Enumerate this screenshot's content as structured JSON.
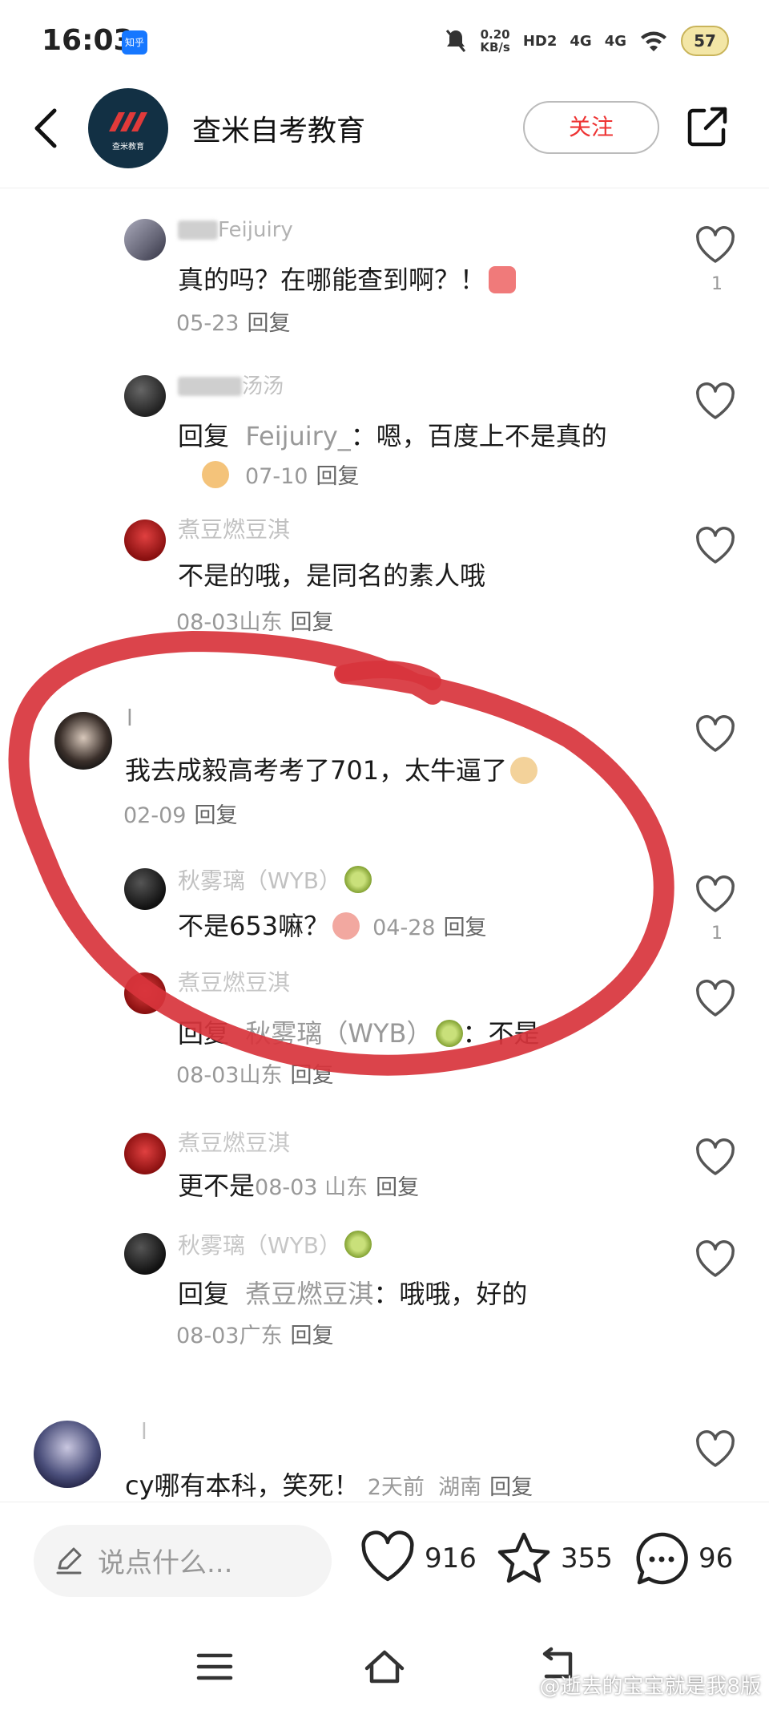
{
  "status_bar": {
    "time": "16:03",
    "app_badge": "知乎",
    "net_speed": "0.20",
    "net_unit": "KB/s",
    "hd": "HD2",
    "sig1": "4G",
    "sig2": "4G",
    "battery": "57"
  },
  "header": {
    "title": "查米自考教育",
    "logo_text": "查米教育",
    "follow_label": "关注"
  },
  "comments": [
    {
      "user": "Feijuiry",
      "text": "真的吗？在哪能查到啊？！",
      "date": "05-23",
      "reply": "回复",
      "likes": "1"
    },
    {
      "user": "汤汤",
      "reply_prefix": "回复",
      "reply_to": "Feijuiry_",
      "text": "：嗯，百度上不是真的",
      "date": "07-10",
      "reply": "回复"
    },
    {
      "user": "煮豆燃豆淇",
      "text": "不是的哦，是同名的素人哦",
      "date": "08-03",
      "loc": "山东",
      "reply": "回复"
    },
    {
      "user": "l",
      "text": "我去成毅高考考了701，太牛逼了",
      "date": "02-09",
      "reply": "回复"
    },
    {
      "user": "秋雾璃（WYB）",
      "text": "不是653嘛？",
      "date": "04-28",
      "reply": "回复",
      "likes": "1"
    },
    {
      "user": "煮豆燃豆淇",
      "reply_prefix": "回复",
      "reply_to": "秋雾璃（WYB）",
      "text": "：不是",
      "date": "08-03",
      "loc": "山东",
      "reply": "回复"
    },
    {
      "user": "煮豆燃豆淇",
      "text": "更不是",
      "date": "08-03",
      "loc": "山东",
      "reply": "回复"
    },
    {
      "user": "秋雾璃（WYB）",
      "reply_prefix": "回复",
      "reply_to": "煮豆燃豆淇",
      "text": "：哦哦，好的",
      "date": "08-03",
      "loc": "广东",
      "reply": "回复"
    },
    {
      "user": "l",
      "text": "cy哪有本科，笑死！",
      "date": "2天前",
      "loc": "湖南",
      "reply": "回复"
    }
  ],
  "bottom_bar": {
    "placeholder": "说点什么...",
    "like_count": "916",
    "star_count": "355",
    "comment_count": "96"
  },
  "watermark": "@逝去的宝宝就是我8版",
  "colors": {
    "accent": "#e33333",
    "annotation": "#d8343c",
    "muted": "#999999"
  }
}
